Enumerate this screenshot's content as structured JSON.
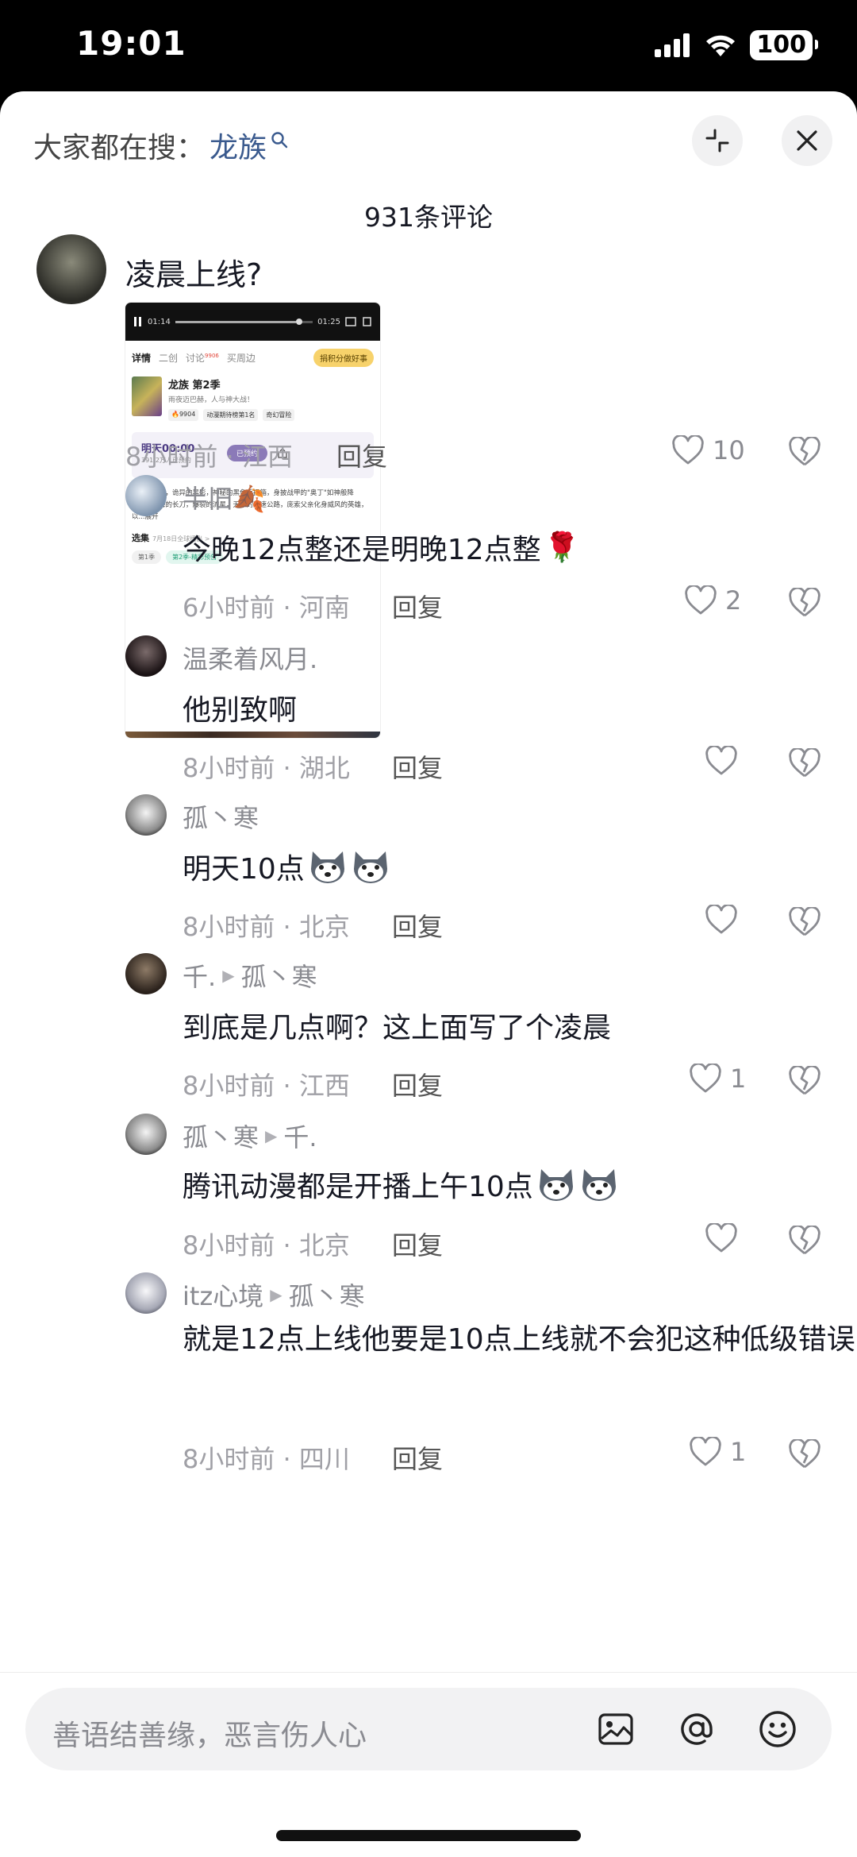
{
  "status_bar": {
    "time": "19:01",
    "battery": "100"
  },
  "header": {
    "search_prefix": "大家都在搜：",
    "search_keyword": "龙族",
    "comment_count": "931条评论"
  },
  "comments": [
    {
      "text": "凌晨上线?",
      "time_loc": "8小时前 · 江西",
      "reply": "回复",
      "likes": "10",
      "attachment": {
        "player_time_start": "01:14",
        "player_time_end": "01:25",
        "tabs": [
          "详情",
          "二创",
          "讨论",
          "买周边"
        ],
        "tab_badge": "9906",
        "pill": "捐积分做好事",
        "title": "龙族 第2季",
        "subtitle": "雨夜迈巴赫，人与神大战！",
        "tags": [
          "🔥9904",
          "动漫期待榜第1名",
          "奇幻冒险"
        ],
        "reserve_time": "明天00:00",
        "reserve_count": "391.2万人已预约",
        "reserve_btn": "已预约",
        "desc": "不详的暴雨，诡异的黑影，神秘的黑色手提箱，身披战甲的\"奥丁\"如神般降临……狂舞的长刀，爆裂的流星，无人的高速公路，庞索父亲化身威风的英雄，以...展开",
        "select_label": "选集",
        "select_note": "7月18日全球播出 >",
        "episodes": [
          "第1季",
          "第2季-精彩预告"
        ]
      }
    },
    {
      "user": "半旧🍂",
      "text": "今晚12点整还是明晚12点整",
      "emoji": "🌹",
      "time_loc": "6小时前 · 河南",
      "reply": "回复",
      "likes": "2"
    },
    {
      "user": "温柔着风月.",
      "text": "他别致啊",
      "time_loc": "8小时前 · 湖北",
      "reply": "回复",
      "likes": ""
    },
    {
      "user": "孤丶寒",
      "text": "明天10点",
      "time_loc": "8小时前 · 北京",
      "reply": "回复",
      "likes": ""
    },
    {
      "user": "千.",
      "reply_to": "孤丶寒",
      "text": "到底是几点啊？这上面写了个凌晨",
      "time_loc": "8小时前 · 江西",
      "reply": "回复",
      "likes": "1"
    },
    {
      "user": "孤丶寒",
      "reply_to": "千.",
      "text": "腾讯动漫都是开播上午10点",
      "time_loc": "8小时前 · 北京",
      "reply": "回复",
      "likes": ""
    },
    {
      "user": "itz心境",
      "reply_to": "孤丶寒",
      "text": "就是12点上线他要是10点上线就不会犯这种低级错误",
      "time_loc": "8小时前 · 四川",
      "reply": "回复",
      "likes": "1"
    }
  ],
  "input": {
    "placeholder": "善语结善缘，恶言伤人心"
  },
  "icons": [
    "search-icon",
    "collapse-icon",
    "close-icon",
    "heart-icon",
    "broken-heart-icon",
    "image-icon",
    "at-icon",
    "emoji-icon"
  ]
}
